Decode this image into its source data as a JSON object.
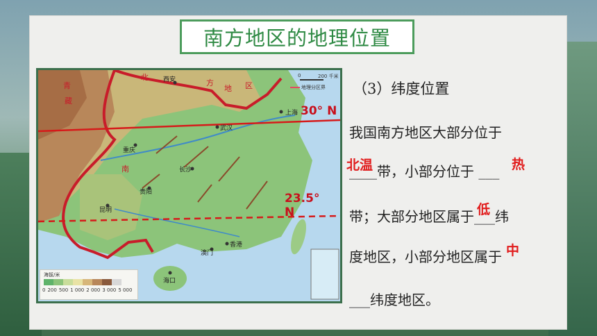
{
  "slide": {
    "title": "南方地区的地理位置",
    "question_heading": "（3）纬度位置",
    "line1": "我国南方地区大部分位于",
    "line2": "____带，小部分位于 ___",
    "line3": "带；大部分地区属于___纬",
    "line4": "度地区，小部分地区属于",
    "line5": "___纬度地区。"
  },
  "answers": {
    "a1": "北温",
    "a2": "热",
    "a3": "低",
    "a4": "中"
  },
  "map": {
    "lat_30_label": "30° N",
    "lat_23_5_label": "23.5° N",
    "scale_zero": "0",
    "scale_km": "200 千米",
    "boundary_legend": "地理分区界",
    "legend_title": "海拔/米",
    "legend_ticks": [
      "0",
      "200",
      "500",
      "1 000",
      "2 000",
      "3 000",
      "5 000"
    ],
    "places": {
      "xian": "西安",
      "wuhan": "武汉",
      "chongqing": "重庆",
      "changsha": "长沙",
      "guiyang": "贵阳",
      "kunming": "昆明",
      "hongkong": "香港",
      "macau": "澳门",
      "haikou": "海口",
      "shanghai": "上海"
    },
    "region_chars": {
      "bei": "北",
      "fang": "方",
      "di": "地",
      "qu": "区",
      "qing": "青",
      "zang": "藏",
      "nan": "南"
    }
  },
  "colors": {
    "title_green": "#2f8a44",
    "answer_red": "#e11c1c",
    "latitude_red": "#d61a1a",
    "boundary_red": "#c81c2a"
  }
}
